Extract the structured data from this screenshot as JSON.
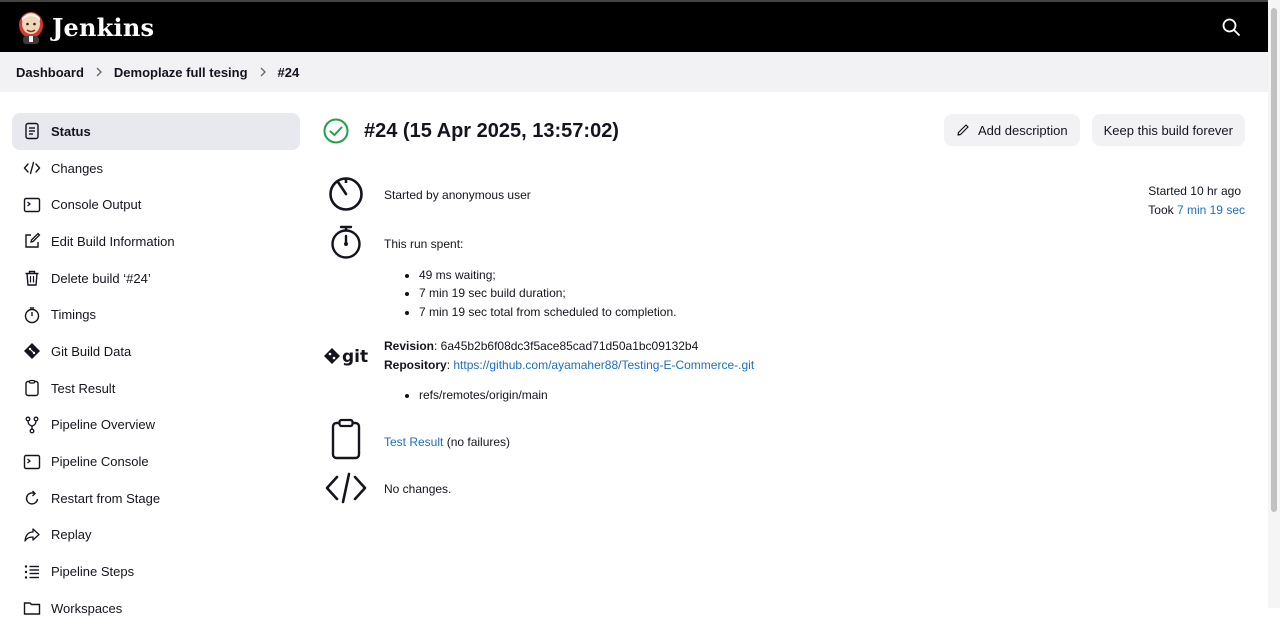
{
  "header": {
    "brand": "Jenkins"
  },
  "breadcrumb": {
    "items": [
      "Dashboard",
      "Demoplaze full tesing",
      "#24"
    ]
  },
  "sidebar": {
    "items": [
      {
        "label": "Status",
        "icon": "status-doc-icon",
        "active": true
      },
      {
        "label": "Changes",
        "icon": "code-icon"
      },
      {
        "label": "Console Output",
        "icon": "terminal-icon"
      },
      {
        "label": "Edit Build Information",
        "icon": "edit-icon"
      },
      {
        "label": "Delete build ‘#24’",
        "icon": "trash-icon"
      },
      {
        "label": "Timings",
        "icon": "stopwatch-icon"
      },
      {
        "label": "Git Build Data",
        "icon": "git-icon"
      },
      {
        "label": "Test Result",
        "icon": "clipboard-icon"
      },
      {
        "label": "Pipeline Overview",
        "icon": "branch-icon"
      },
      {
        "label": "Pipeline Console",
        "icon": "terminal-icon"
      },
      {
        "label": "Restart from Stage",
        "icon": "restart-icon"
      },
      {
        "label": "Replay",
        "icon": "replay-icon"
      },
      {
        "label": "Pipeline Steps",
        "icon": "list-icon"
      },
      {
        "label": "Workspaces",
        "icon": "folder-icon"
      }
    ]
  },
  "main": {
    "title": "#24 (15 Apr 2025, 13:57:02)",
    "add_description": "Add description",
    "keep_forever": "Keep this build forever",
    "started_by": "Started by anonymous user",
    "started_ago": "Started 10 hr ago",
    "took_prefix": "Took ",
    "took_value": "7 min 19 sec",
    "run_spent": "This run spent:",
    "run_items": [
      "49 ms waiting;",
      "7 min 19 sec build duration;",
      "7 min 19 sec total from scheduled to completion."
    ],
    "revision_label": "Revision",
    "revision_value": ": 6a45b2b6f08dc3f5ace85cad71d50a1bc09132b4",
    "repository_label": "Repository",
    "repository_sep": ": ",
    "repository_url": "https://github.com/ayamaher88/Testing-E-Commerce-.git",
    "refs": [
      "refs/remotes/origin/main"
    ],
    "git_text": "git",
    "test_result_link": "Test Result",
    "test_result_suffix": " (no failures)",
    "no_changes": "No changes."
  },
  "colors": {
    "link": "#1f6dc6",
    "success": "#1ea446",
    "header_bg": "#000000",
    "breadcrumb_bg": "#f2f2f5",
    "active_bg": "#e8e8ef"
  }
}
